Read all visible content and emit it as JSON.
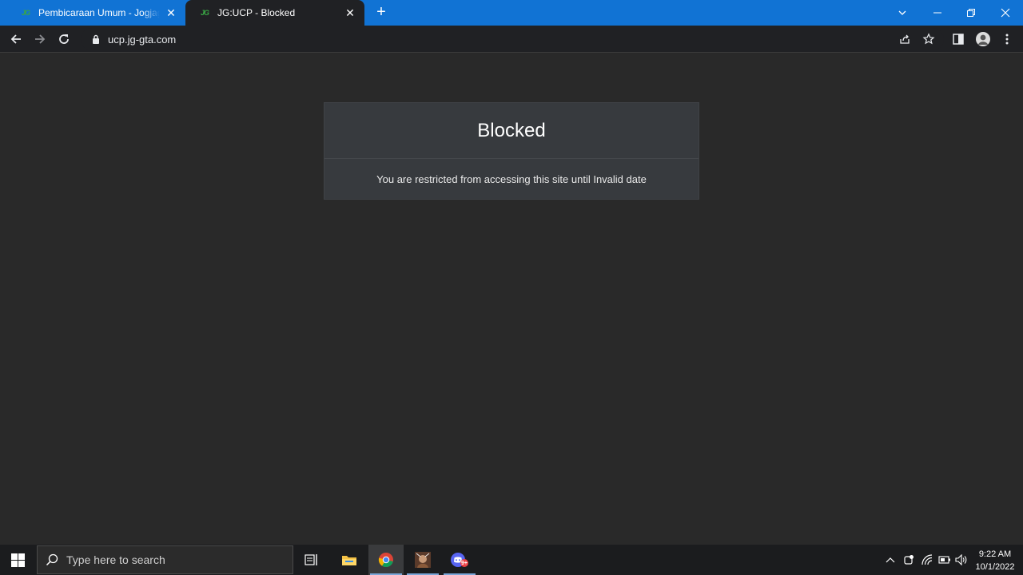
{
  "browser": {
    "tabs": [
      {
        "favicon": "JG",
        "title": "Pembicaraan Umum - Jogjagamers"
      },
      {
        "favicon": "JG",
        "title": "JG:UCP - Blocked"
      }
    ],
    "url": "ucp.jg-gta.com",
    "accent": "#1173d4"
  },
  "page": {
    "heading": "Blocked",
    "message": "You are restricted from accessing this site until Invalid date"
  },
  "taskbar": {
    "search_placeholder": "Type here to search",
    "time": "9:22 AM",
    "date": "10/1/2022",
    "discord_badge": "9+"
  }
}
